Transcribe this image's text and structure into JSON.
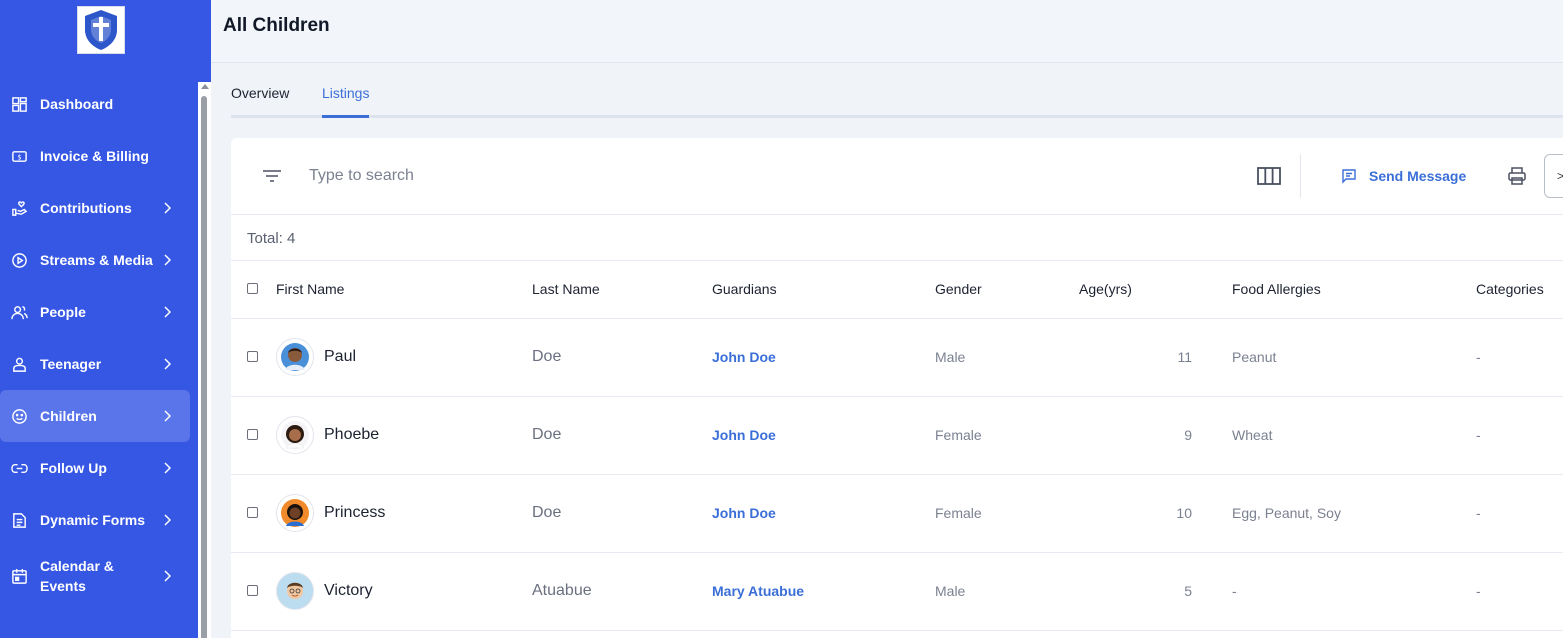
{
  "sidebar": {
    "logo_alt": "Academy logo",
    "items": [
      {
        "label": "Dashboard",
        "icon": "dashboard-icon",
        "chevron": false
      },
      {
        "label": "Invoice & Billing",
        "icon": "invoice-icon",
        "chevron": false
      },
      {
        "label": "Contributions",
        "icon": "contributions-icon",
        "chevron": true
      },
      {
        "label": "Streams & Media",
        "icon": "play-icon",
        "chevron": true
      },
      {
        "label": "People",
        "icon": "people-icon",
        "chevron": true
      },
      {
        "label": "Teenager",
        "icon": "user-icon",
        "chevron": true
      },
      {
        "label": "Children",
        "icon": "smile-icon",
        "chevron": true,
        "active": true
      },
      {
        "label": "Follow Up",
        "icon": "link-icon",
        "chevron": true
      },
      {
        "label": "Dynamic Forms",
        "icon": "form-icon",
        "chevron": true
      },
      {
        "label": "Calendar & Events",
        "icon": "calendar-icon",
        "chevron": true
      }
    ]
  },
  "header": {
    "title": "All Children"
  },
  "tabs": [
    {
      "label": "Overview",
      "active": false
    },
    {
      "label": "Listings",
      "active": true
    }
  ],
  "toolbar": {
    "search_placeholder": "Type to search",
    "send_message_label": "Send Message",
    "more_label": ">"
  },
  "total_text": "Total: 4",
  "table": {
    "columns": [
      "First Name",
      "Last Name",
      "Guardians",
      "Gender",
      "Age(yrs)",
      "Food Allergies",
      "Categories"
    ],
    "rows": [
      {
        "first_name": "Paul",
        "last_name": "Doe",
        "guardian": "John Doe",
        "gender": "Male",
        "age": "11",
        "allergies": "Peanut",
        "categories": "-"
      },
      {
        "first_name": "Phoebe",
        "last_name": "Doe",
        "guardian": "John Doe",
        "gender": "Female",
        "age": "9",
        "allergies": "Wheat",
        "categories": "-"
      },
      {
        "first_name": "Princess",
        "last_name": "Doe",
        "guardian": "John Doe",
        "gender": "Female",
        "age": "10",
        "allergies": "Egg, Peanut, Soy",
        "categories": "-"
      },
      {
        "first_name": "Victory",
        "last_name": "Atuabue",
        "guardian": "Mary Atuabue",
        "gender": "Male",
        "age": "5",
        "allergies": "-",
        "categories": "-"
      }
    ]
  },
  "colors": {
    "sidebar": "#3557e4",
    "accent": "#3b6fd8"
  }
}
